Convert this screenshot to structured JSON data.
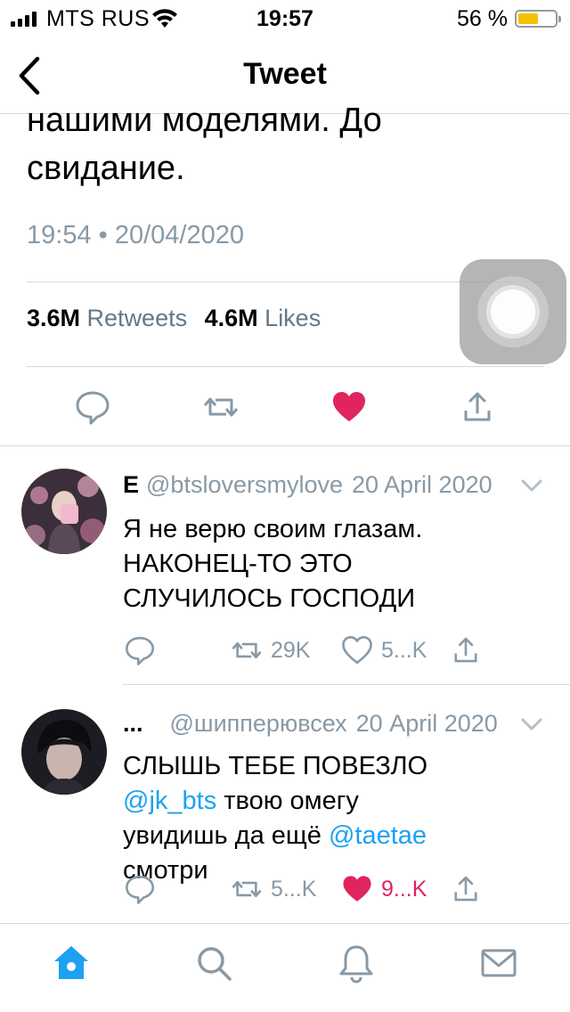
{
  "status_bar": {
    "carrier": "MTS RUS",
    "time": "19:57",
    "battery": "56 %",
    "battery_level": 0.56,
    "battery_color": "#f4c300"
  },
  "header": {
    "title": "Tweet",
    "back_icon": "chevron-left-icon"
  },
  "tweet": {
    "text_line1": "нашими моделями. До",
    "text_line2": "свидание.",
    "time": "19:54",
    "separator": "•",
    "date": "20/04/2020",
    "retweets_count": "3.6M",
    "retweets_label": "Retweets",
    "likes_count": "4.6M",
    "likes_label": "Likes",
    "actions": {
      "reply_icon": "reply-bubble-icon",
      "retweet_icon": "retweet-icon",
      "like_icon": "heart-filled-icon",
      "share_icon": "share-icon"
    },
    "liked": true,
    "like_color": "#e0245e"
  },
  "replies": [
    {
      "name": "E",
      "handle": "@btsloversmylove",
      "date": "20 April 2020",
      "text_lines": [
        "Я не верю своим глазам.",
        "НАКОНЕЦ-ТО ЭТО",
        "СЛУЧИЛОСЬ ГОСПОДИ"
      ],
      "retweets": "29K",
      "likes": "5...K",
      "liked": false
    },
    {
      "name": "...",
      "handle": "@шипперювсех",
      "date": "20 April 2020",
      "text_line1": "СЛЫШЬ ТЕБЕ ПОВЕЗЛО",
      "mention1": "@jk_bts",
      "text_line2_rest": " твою омегу",
      "text_line3_pre": "увидишь да ещё ",
      "mention2": "@taetae",
      "text_line4": "смотри",
      "retweets": "5...K",
      "likes": "9...K",
      "liked": true
    }
  ],
  "tab_bar": {
    "home_icon": "home-icon",
    "search_icon": "search-icon",
    "notifications_icon": "bell-icon",
    "messages_icon": "mail-icon",
    "active_color": "#1da1f2",
    "inactive_color": "#8899a6"
  }
}
